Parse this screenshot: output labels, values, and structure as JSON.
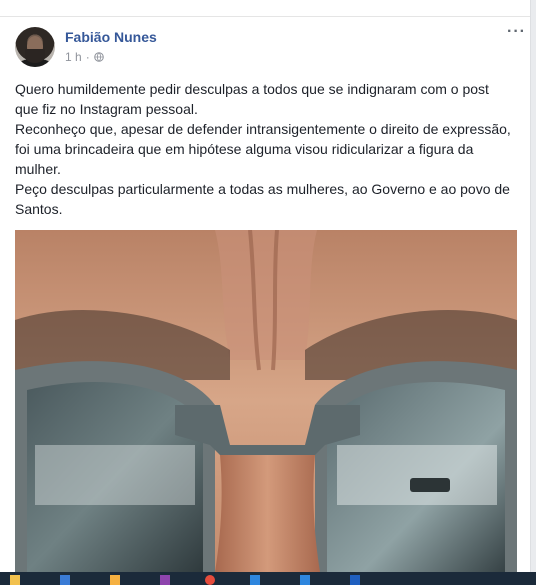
{
  "post": {
    "author": "Fabião Nunes",
    "time": "1 h",
    "separator": "·",
    "more_label": "···",
    "paragraphs": [
      "Quero humildemente pedir desculpas a todos que se indignaram com o post que fiz no Instagram pessoal.",
      "Reconheço que, apesar de defender intransigentemente o direito de expressão, foi uma brincadeira que em hipótese alguma visou ridicularizar a figura da mulher.",
      "Peço desculpas particularmente a todas as mulheres, ao Governo e ao povo de Santos."
    ]
  },
  "colors": {
    "name": "#365899",
    "text": "#1d2129",
    "meta": "#90949c",
    "background": "#e9ebee",
    "taskbar": "#1b2a3a"
  },
  "icons": {
    "privacy": "globe-icon",
    "options": "more-options-icon"
  }
}
